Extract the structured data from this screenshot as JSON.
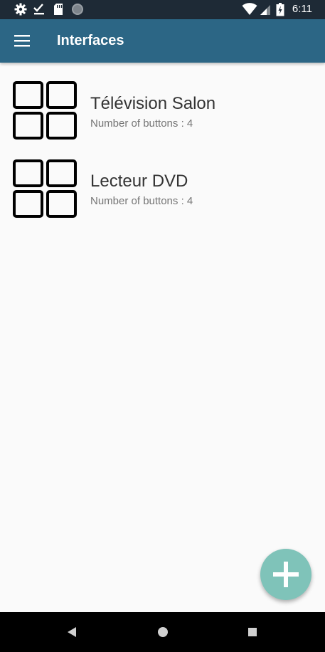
{
  "status_bar": {
    "time": "6:11",
    "left_icons": [
      "gear-icon",
      "download-check-icon",
      "sd-card-icon",
      "sync-circle-icon"
    ],
    "right_icons": [
      "wifi-icon",
      "signal-icon",
      "battery-icon"
    ]
  },
  "app_bar": {
    "title": "Interfaces",
    "menu_icon": "hamburger-menu-icon"
  },
  "interfaces": [
    {
      "name": "Télévision Salon",
      "subtitle": "Number of buttons : 4",
      "icon": "four-squares-grid-icon"
    },
    {
      "name": "Lecteur DVD",
      "subtitle": "Number of buttons : 4",
      "icon": "four-squares-grid-icon"
    }
  ],
  "fab": {
    "icon": "plus-icon",
    "color": "#7fc3b9"
  },
  "nav_bar": {
    "icons": [
      "back-triangle-icon",
      "home-circle-icon",
      "recents-square-icon"
    ]
  },
  "colors": {
    "app_bar": "#2c6685",
    "status_bar": "#1e2a36",
    "background": "#fafafa",
    "fab": "#7fc3b9"
  }
}
